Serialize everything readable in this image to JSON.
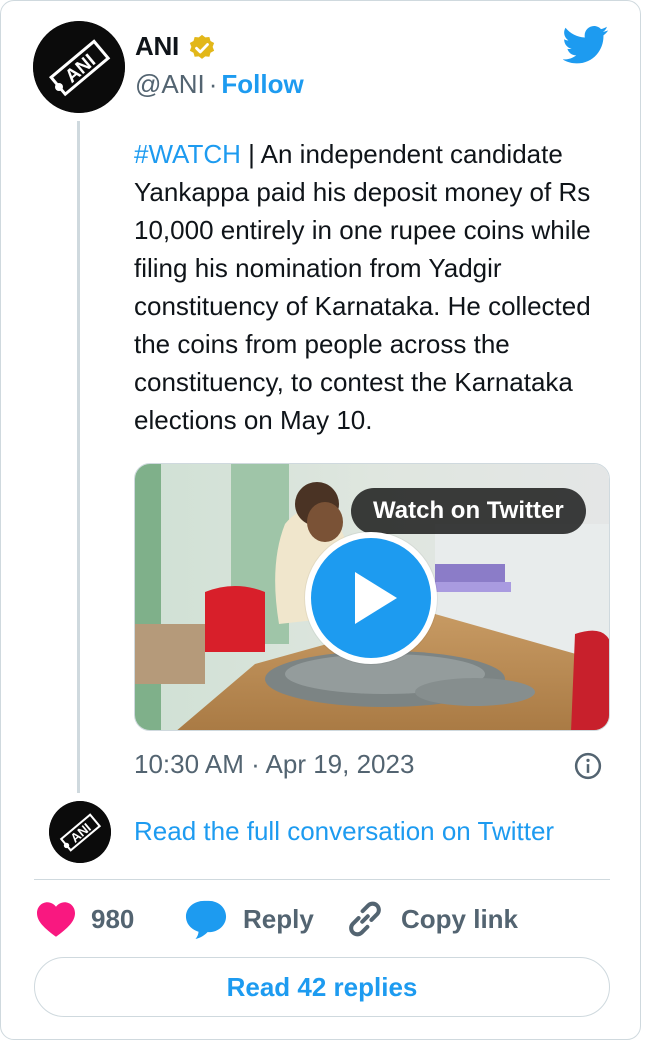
{
  "author": {
    "name": "ANI",
    "handle": "@ANI",
    "separator": "·",
    "follow_label": "Follow",
    "avatar_logo_text": "ANI"
  },
  "tweet": {
    "hashtag": "#WATCH",
    "text": " | An independent candidate Yankappa paid his deposit money of Rs 10,000 entirely in one rupee coins while filing his nomination from Yadgir constituency of Karnataka. He collected the coins from people across the constituency, to contest the Karnataka elections on May 10.",
    "timestamp": "10:30 AM · Apr 19, 2023"
  },
  "media": {
    "overlay_label": "Watch on Twitter"
  },
  "conversation": {
    "link_label": "Read the full conversation on Twitter"
  },
  "actions": {
    "like_count": "980",
    "reply_label": "Reply",
    "copy_label": "Copy link"
  },
  "replies": {
    "button_label": "Read 42 replies"
  },
  "colors": {
    "accent": "#1d9bf0",
    "like": "#f91880",
    "verified": "#e2b719",
    "text": "#0f1419",
    "secondary": "#536471",
    "border": "#cfd9de"
  }
}
